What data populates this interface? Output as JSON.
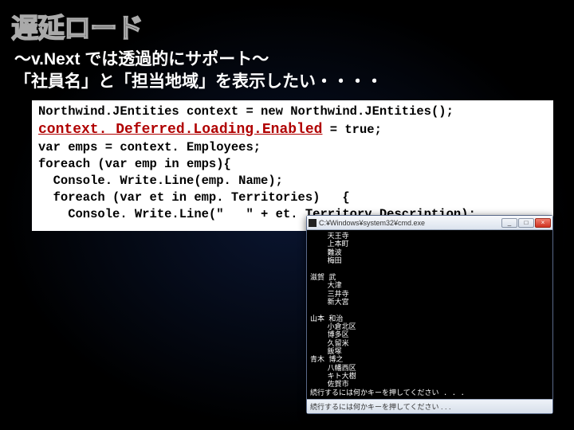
{
  "title": "遅延ロード",
  "subtitle_line1": "～v.Next では透過的にサポート～",
  "subtitle_line2": "「社員名」と「担当地域」を表示したい・・・・",
  "code": {
    "l1": "Northwind.JEntities context = new Northwind.JEntities();",
    "hl": "context. Deferred.Loading.Enabled",
    "l2_tail": " = true;",
    "l3": "var emps = context. Employees;",
    "l4": "foreach (var emp in emps){",
    "l5": "  Console. Write.Line(emp. Name);",
    "l6": "  foreach (var et in emp. Territories)   {",
    "l7": "    Console. Write.Line(\"   \" + et. Territory.Description);"
  },
  "console": {
    "title": "C:¥Windows¥system32¥cmd.exe",
    "body": "    天王寺\n    上本町\n    難波\n    梅田\n\n滋賀 武\n    大津\n    三井寺\n    新大宮\n\n山本 和治\n    小倉北区\n    博多区\n    久留米\n    飯塚\n青木 博之\n    八幡西区\n    キト大樹\n    佐賀市\n続行するには何かキーを押してください . . .",
    "status": "続行するには何かキーを押してください . . ."
  }
}
